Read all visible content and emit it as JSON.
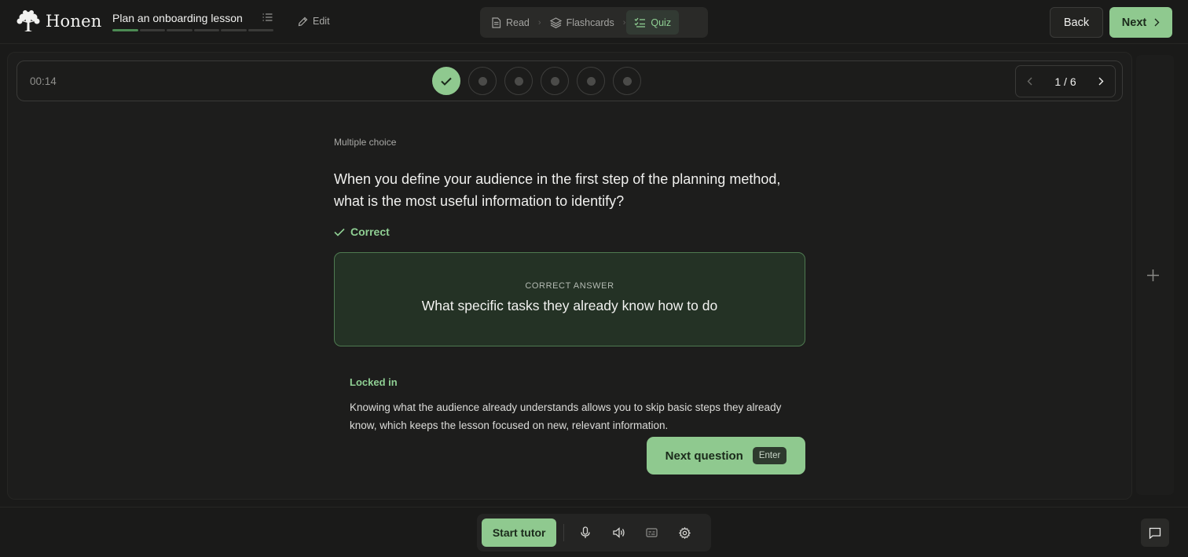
{
  "app": {
    "name": "Honen"
  },
  "lesson": {
    "title": "Plan an onboarding lesson",
    "progress_segments": 6,
    "progress_done": 1
  },
  "header": {
    "edit_label": "Edit",
    "modes": [
      {
        "label": "Read",
        "icon": "document-icon"
      },
      {
        "label": "Flashcards",
        "icon": "layers-icon"
      },
      {
        "label": "Quiz",
        "icon": "checklist-icon",
        "active": true
      }
    ],
    "back_label": "Back",
    "next_label": "Next"
  },
  "quiz": {
    "timer": "00:14",
    "pager": "1 / 6",
    "question_type": "Multiple choice",
    "question": "When you define your audience in the first step of the planning method, what is the most useful information to identify?",
    "result": "Correct",
    "answer_caption": "CORRECT ANSWER",
    "answer_text": "What specific tasks they already know how to do",
    "explanation_title": "Locked in",
    "explanation": "Knowing what the audience already understands allows you to skip basic steps they already know, which keeps the lesson focused on new, relevant information.",
    "next_question_label": "Next question",
    "next_question_key": "Enter"
  },
  "bottom": {
    "start_tutor_label": "Start tutor"
  },
  "colors": {
    "accent": "#8fc98f",
    "background": "#1a1a19",
    "answer_bg": "#243225"
  }
}
